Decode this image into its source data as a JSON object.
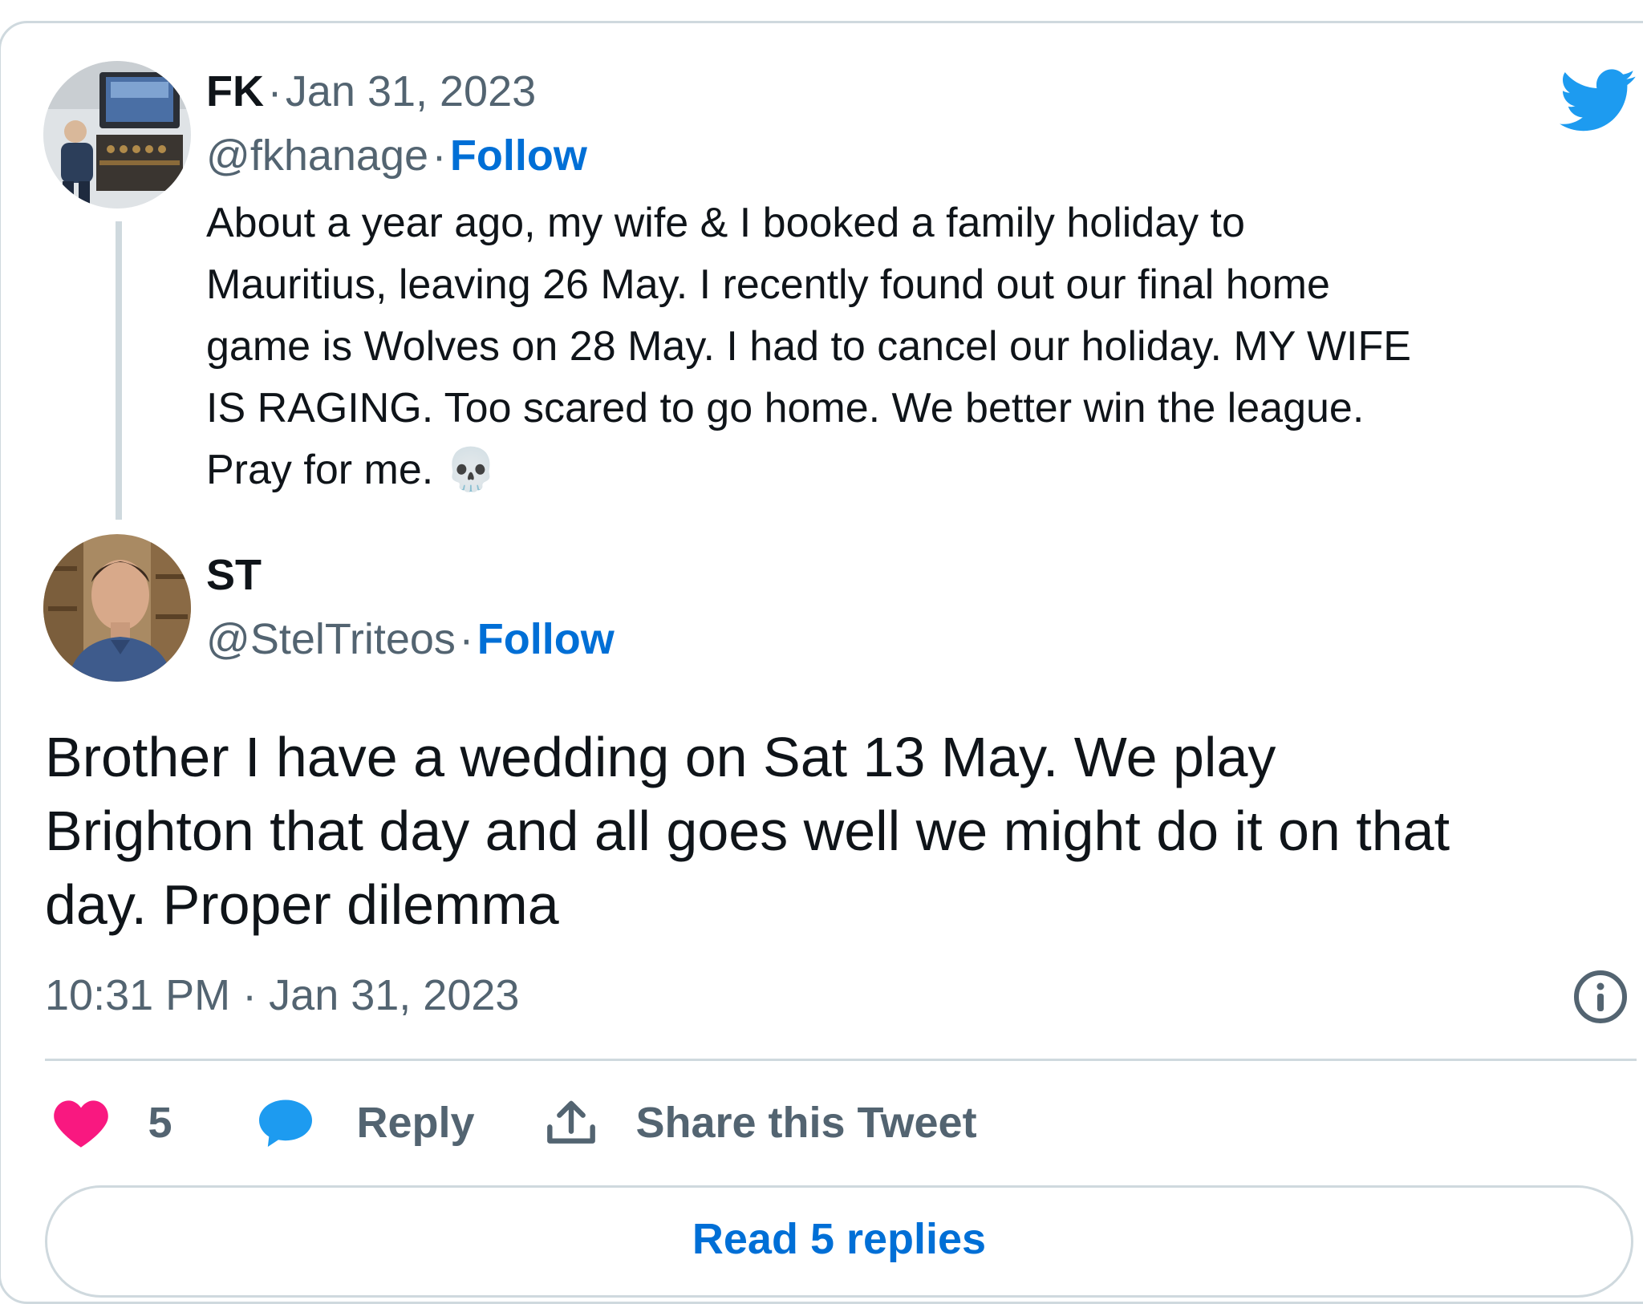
{
  "parent_tweet": {
    "name": "FK",
    "separator": "·",
    "date": "Jan 31, 2023",
    "handle": "@fkhanage",
    "follow_label": "Follow",
    "text": "About a year ago, my wife & I booked a family holiday to\nMauritius, leaving 26 May. I recently found out our final home\ngame is Wolves on 28 May. I had to cancel our holiday. MY WIFE\nIS RAGING. Too scared to go home. We better win the league.\nPray for me. 💀"
  },
  "main_tweet": {
    "name": "ST",
    "handle": "@StelTriteos",
    "separator": "·",
    "follow_label": "Follow",
    "text": "Brother I have a wedding on Sat 13 May. We play\nBrighton that day and all goes well we might do it on that\nday. Proper dilemma",
    "time": "10:31 PM",
    "date": "Jan 31, 2023"
  },
  "actions": {
    "like_count": "5",
    "reply_label": "Reply",
    "share_label": "Share this Tweet"
  },
  "read_replies_label": "Read 5 replies",
  "colors": {
    "brand_blue": "#1d9bf0",
    "link_blue": "#006fd6",
    "like_pink": "#f91880",
    "muted_text": "#536471",
    "border": "#cfd9de"
  },
  "icons": [
    "twitter-bird-icon",
    "heart-icon",
    "reply-bubble-icon",
    "share-upload-icon",
    "info-icon",
    "skull-emoji"
  ]
}
